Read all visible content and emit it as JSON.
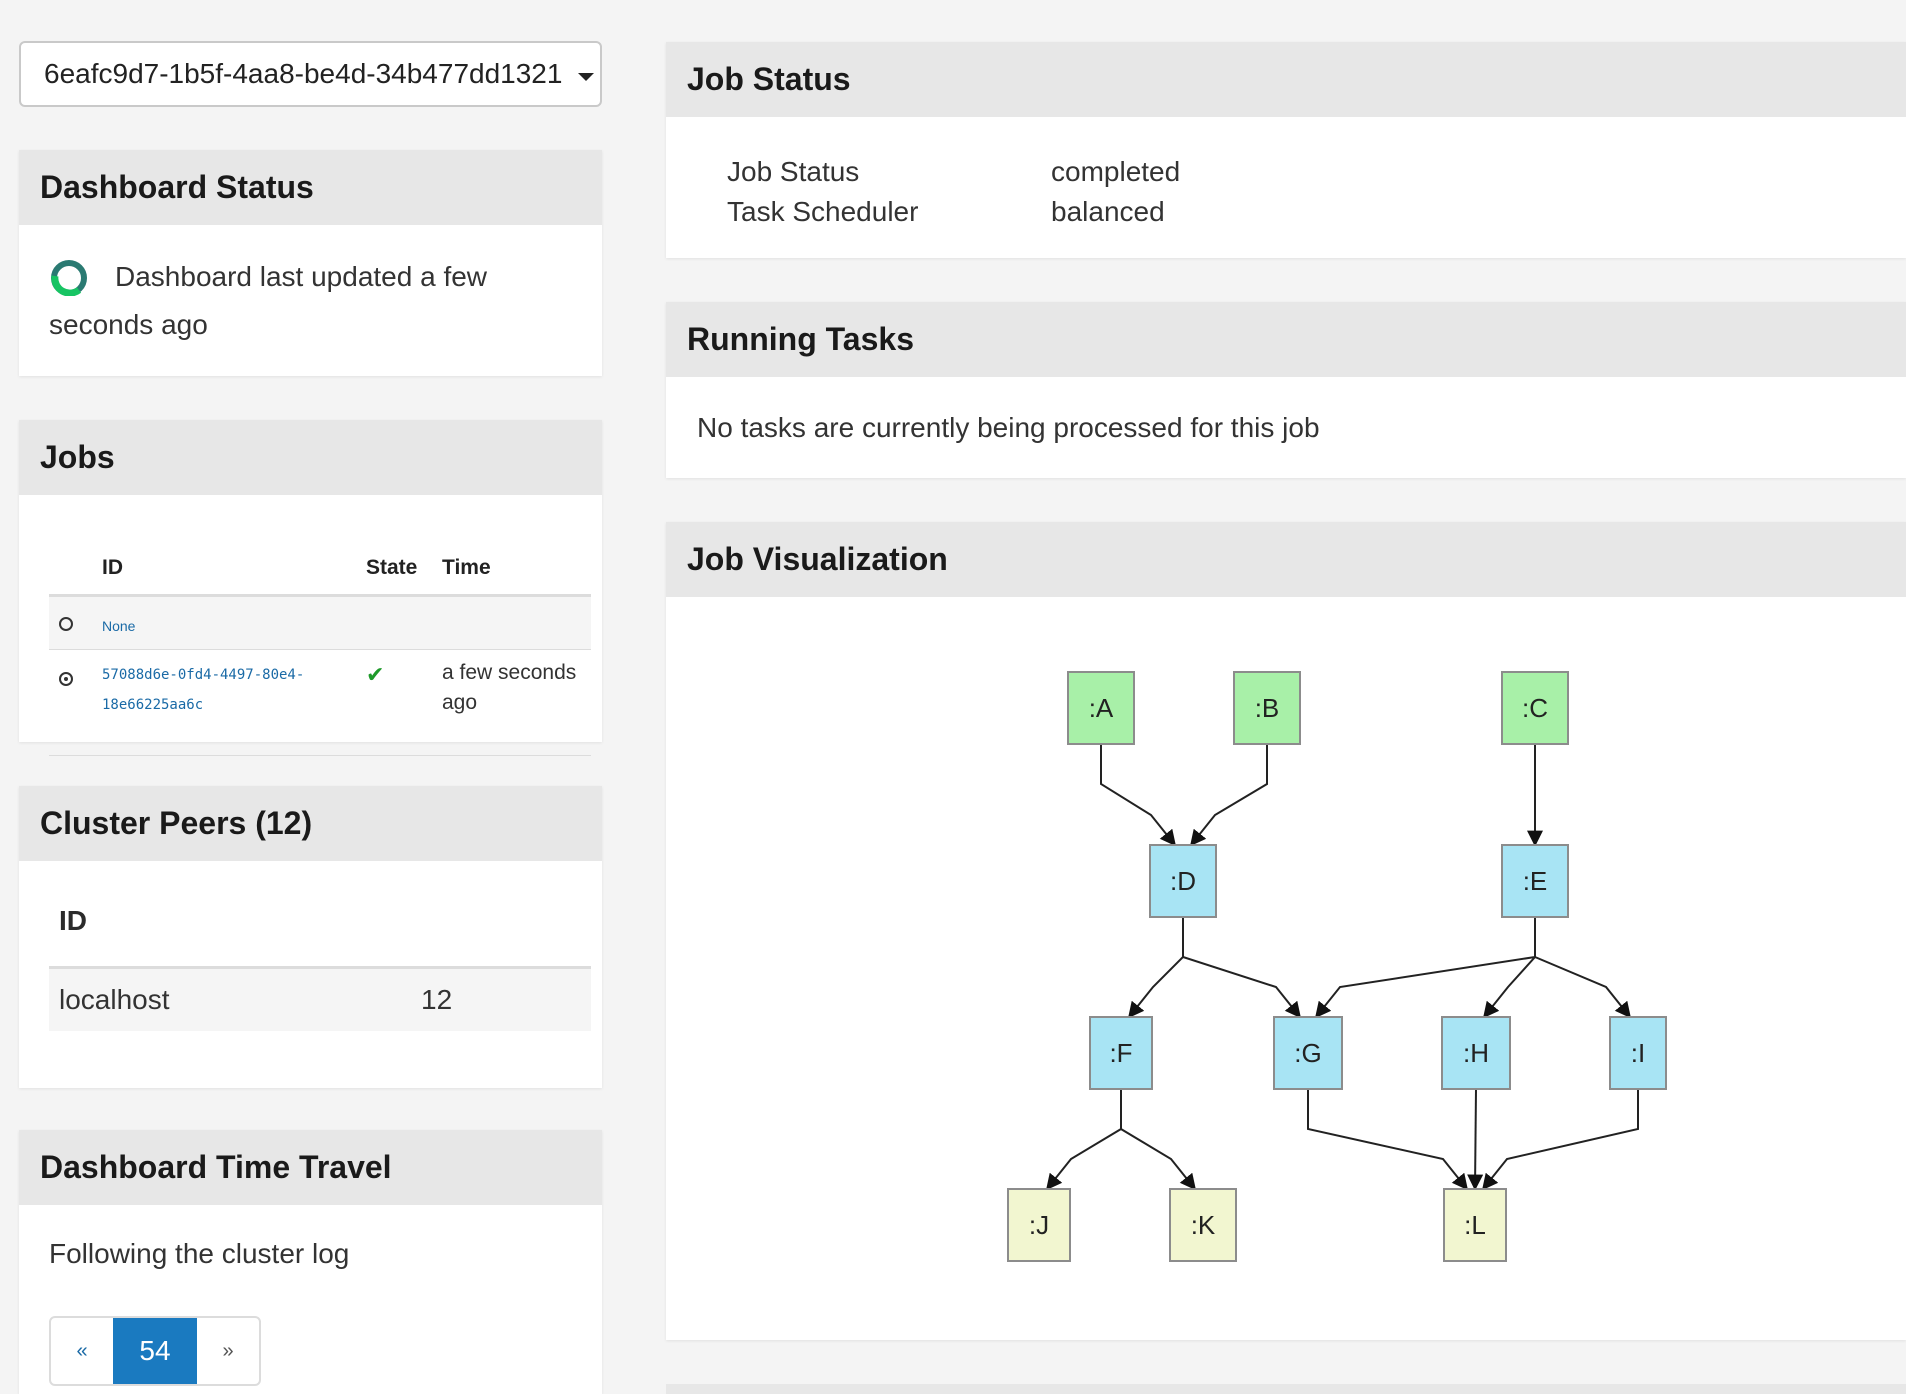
{
  "job_select": {
    "value": "6eafc9d7-1b5f-4aa8-be4d-34b477dd1321"
  },
  "dashboard_status": {
    "title": "Dashboard Status",
    "text": "Dashboard last updated a few seconds ago"
  },
  "jobs": {
    "title": "Jobs",
    "headers": {
      "id": "ID",
      "state": "State",
      "time": "Time"
    },
    "rows": [
      {
        "id": "None",
        "selected": false,
        "state": "",
        "time": ""
      },
      {
        "id_line1": "57088d6e-0fd4-4497-80e4-",
        "id_line2": "18e66225aa6c",
        "selected": true,
        "state": "✔",
        "time": "a few seconds ago"
      }
    ]
  },
  "cluster_peers": {
    "title": "Cluster Peers (12)",
    "header_id": "ID",
    "rows": [
      {
        "id": "localhost",
        "count": "12"
      }
    ]
  },
  "time_travel": {
    "title": "Dashboard Time Travel",
    "text": "Following the cluster log",
    "pager": {
      "prev": "«",
      "current": "54",
      "next": "»"
    }
  },
  "job_status": {
    "title": "Job Status",
    "rows": [
      {
        "key": "Job Status",
        "value": "completed"
      },
      {
        "key": "Task Scheduler",
        "value": "balanced"
      }
    ]
  },
  "running_tasks": {
    "title": "Running Tasks",
    "text": "No tasks are currently being processed for this job"
  },
  "visualization": {
    "title": "Job Visualization",
    "colors": {
      "input": "#a8f0a8",
      "function": "#a8e4f4",
      "output": "#f2f6d0"
    },
    "nodes": {
      "A": ":A",
      "B": ":B",
      "C": ":C",
      "D": ":D",
      "E": ":E",
      "F": ":F",
      "G": ":G",
      "H": ":H",
      "I": ":I",
      "J": ":J",
      "K": ":K",
      "L": ":L"
    },
    "edges": [
      [
        "A",
        "D"
      ],
      [
        "B",
        "D"
      ],
      [
        "C",
        "E"
      ],
      [
        "D",
        "F"
      ],
      [
        "D",
        "G"
      ],
      [
        "E",
        "G"
      ],
      [
        "E",
        "H"
      ],
      [
        "E",
        "I"
      ],
      [
        "F",
        "J"
      ],
      [
        "F",
        "K"
      ],
      [
        "G",
        "L"
      ],
      [
        "H",
        "L"
      ],
      [
        "I",
        "L"
      ]
    ]
  }
}
